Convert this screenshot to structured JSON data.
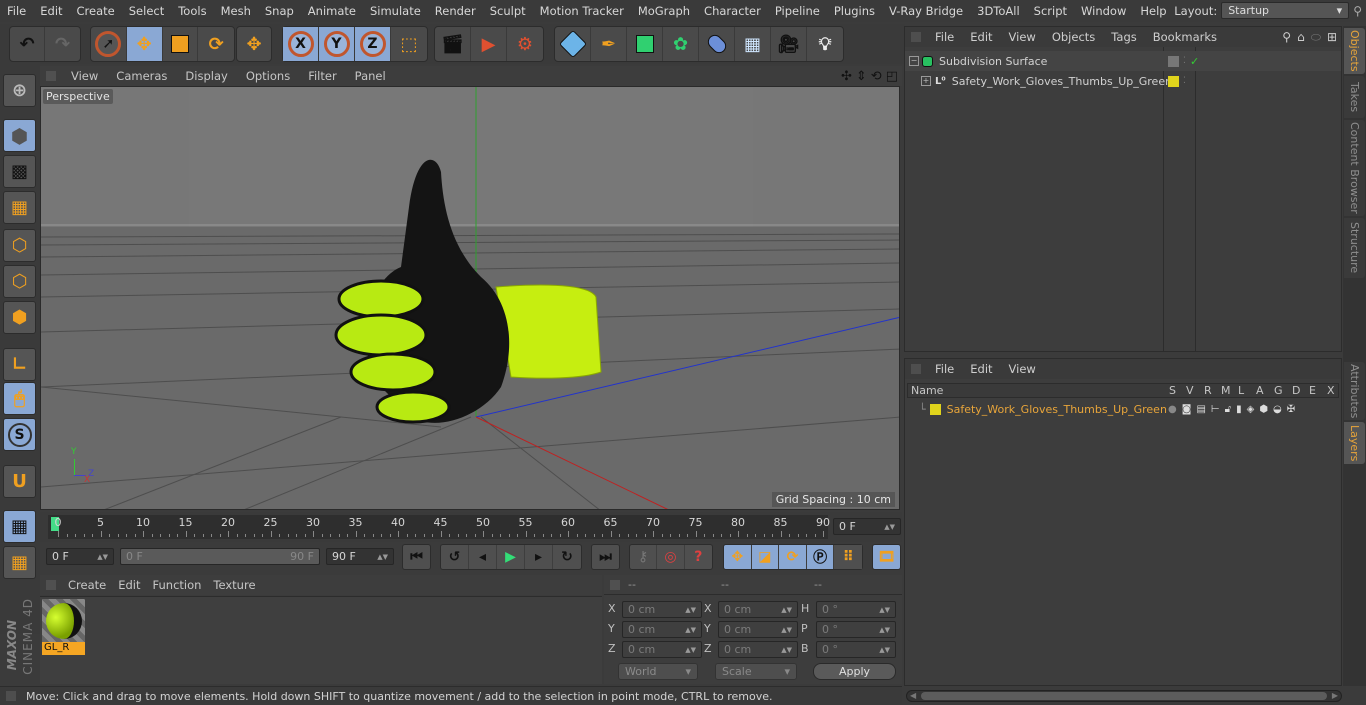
{
  "menubar": {
    "items": [
      "File",
      "Edit",
      "Create",
      "Select",
      "Tools",
      "Mesh",
      "Snap",
      "Animate",
      "Simulate",
      "Render",
      "Sculpt",
      "Motion Tracker",
      "MoGraph",
      "Character",
      "Pipeline",
      "Plugins",
      "V-Ray Bridge",
      "3DToAll",
      "Script",
      "Window",
      "Help"
    ],
    "layout_label": "Layout:",
    "layout_value": "Startup"
  },
  "toolbar": {
    "axis_x": "X",
    "axis_y": "Y",
    "axis_z": "Z"
  },
  "viewport": {
    "menu": [
      "View",
      "Cameras",
      "Display",
      "Options",
      "Filter",
      "Panel"
    ],
    "camera_label": "Perspective",
    "grid_spacing": "Grid Spacing : 10 cm",
    "axis_labels": {
      "y": "Y",
      "z": "Z",
      "x": "X"
    }
  },
  "timeline": {
    "ticks": [
      "0",
      "5",
      "10",
      "15",
      "20",
      "25",
      "30",
      "35",
      "40",
      "45",
      "50",
      "55",
      "60",
      "65",
      "70",
      "75",
      "80",
      "85",
      "90"
    ],
    "current_frame": "0 F",
    "start_field": "0 F",
    "range_start": "0 F",
    "range_end": "90 F",
    "end_field": "90 F"
  },
  "material_manager": {
    "menu": [
      "Create",
      "Edit",
      "Function",
      "Texture"
    ],
    "materials": [
      {
        "name": "GL_R"
      }
    ]
  },
  "coordinates": {
    "headers": [
      "--",
      "--",
      "--"
    ],
    "rows": [
      {
        "l1": "X",
        "v1": "0 cm",
        "l2": "X",
        "v2": "0 cm",
        "l3": "H",
        "v3": "0 °"
      },
      {
        "l1": "Y",
        "v1": "0 cm",
        "l2": "Y",
        "v2": "0 cm",
        "l3": "P",
        "v3": "0 °"
      },
      {
        "l1": "Z",
        "v1": "0 cm",
        "l2": "Z",
        "v2": "0 cm",
        "l3": "B",
        "v3": "0 °"
      }
    ],
    "mode_select": "World",
    "size_select": "Scale",
    "apply_label": "Apply"
  },
  "status": {
    "text": "Move: Click and drag to move elements. Hold down SHIFT to quantize movement / add to the selection in point mode, CTRL to remove."
  },
  "object_manager": {
    "menu": [
      "File",
      "Edit",
      "View",
      "Objects",
      "Tags",
      "Bookmarks"
    ],
    "objects": [
      {
        "name": "Subdivision Surface",
        "type": "subdivision"
      },
      {
        "name": "Safety_Work_Gloves_Thumbs_Up_Green",
        "type": "null",
        "layer_color": "#e0d41c"
      }
    ]
  },
  "layer_manager": {
    "menu": [
      "File",
      "Edit",
      "View"
    ],
    "columns": [
      "Name",
      "S",
      "V",
      "R",
      "M",
      "L",
      "A",
      "G",
      "D",
      "E",
      "X"
    ],
    "layers": [
      {
        "name": "Safety_Work_Gloves_Thumbs_Up_Green",
        "color": "#e0d41c"
      }
    ]
  },
  "side_tabs": {
    "top": [
      "Objects",
      "Takes",
      "Content Browser",
      "Structure"
    ],
    "bottom": [
      "Attributes",
      "Layers"
    ]
  },
  "branding": {
    "maxon": "MAXON",
    "product": "CINEMA 4D"
  },
  "colors": {
    "accent": "#e8a53a",
    "selected": "#8aa8d4",
    "layer_yellow": "#e0d41c"
  }
}
